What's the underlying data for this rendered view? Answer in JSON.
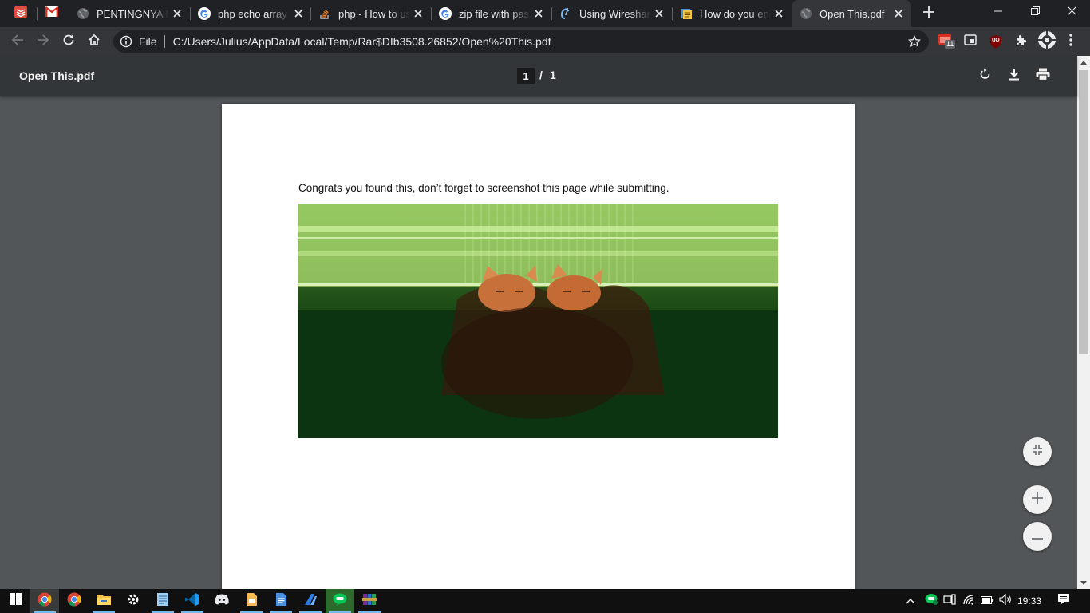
{
  "tabs": [
    {
      "title": "PENTINGNYA MEMAHAMI",
      "favicon": "globe-icon"
    },
    {
      "title": "php echo array - Google Search",
      "favicon": "google-icon"
    },
    {
      "title": "php - How to use",
      "favicon": "stackoverflow-icon"
    },
    {
      "title": "zip file with password",
      "favicon": "google-icon"
    },
    {
      "title": "Using Wireshark",
      "favicon": "wireshark-icon"
    },
    {
      "title": "How do you encrypt",
      "favicon": "document-icon"
    },
    {
      "title": "Open This.pdf",
      "favicon": "globe-icon",
      "active": true
    }
  ],
  "omnibox": {
    "scheme_label": "File",
    "url": "C:/Users/Julius/AppData/Local/Temp/Rar$DIb3508.26852/Open%20This.pdf"
  },
  "extensions": {
    "calendar_badge": "11",
    "ublock_label": "uO"
  },
  "pdf": {
    "title": "Open This.pdf",
    "current_page": "1",
    "page_separator": "/",
    "total_pages": "1",
    "page_text": "Congrats you found this, don’t forget to screenshot this page while submitting."
  },
  "taskbar": {
    "apps": [
      "chrome",
      "chrome",
      "file-explorer",
      "settings",
      "notepad",
      "vscode",
      "discord",
      "document",
      "docs",
      "app-blue",
      "line",
      "winrar"
    ],
    "clock": "19:33"
  },
  "colors": {
    "tabstrip": "#202124",
    "toolbar": "#35363a",
    "pdf_toolbar": "#323639",
    "viewer_bg": "#525659",
    "taskbar": "#101010"
  }
}
